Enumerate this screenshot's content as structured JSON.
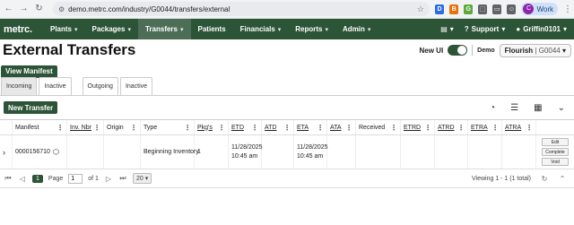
{
  "browser": {
    "url": "demo.metrc.com/industry/G0044/transfers/external",
    "profile_initial": "C",
    "profile_label": "Work",
    "ext_colors": [
      "#2d6cdf",
      "#e8710a",
      "#5fa83b",
      "#5f6368"
    ]
  },
  "nav": {
    "logo": "metrc.",
    "items": [
      {
        "label": "Plants"
      },
      {
        "label": "Packages"
      },
      {
        "label": "Transfers"
      },
      {
        "label": "Patients"
      },
      {
        "label": "Financials"
      },
      {
        "label": "Reports"
      },
      {
        "label": "Admin"
      }
    ],
    "active_index": 2,
    "support_label": "Support",
    "user_label": "Griffin0101"
  },
  "page": {
    "title": "External Transfers",
    "new_ui_label": "New UI",
    "demo_label": "Demo",
    "facility_name": "Flourish",
    "facility_code": "| G0044",
    "view_manifest_label": "View Manifest"
  },
  "tabs": [
    {
      "label": "Incoming"
    },
    {
      "label": "Inactive"
    },
    {
      "label": "Outgoing"
    },
    {
      "label": "Inactive"
    }
  ],
  "toolbar": {
    "new_transfer_label": "New Transfer"
  },
  "grid": {
    "columns": [
      "Manifest",
      "Inv. Nbr",
      "Origin",
      "Type",
      "Pkg's",
      "ETD",
      "ATD",
      "ETA",
      "ATA",
      "Received",
      "ETRD",
      "ATRD",
      "ETRA",
      "ATRA"
    ],
    "rows": [
      {
        "manifest": "0000156710",
        "inv_nbr": "",
        "origin": "",
        "type": "Beginning Inventory",
        "pkgs": "1",
        "etd_date": "11/28/2025",
        "etd_time": "10:45 am",
        "atd": "",
        "eta_date": "11/28/2025",
        "eta_time": "10:45 am",
        "ata": "",
        "received": "",
        "etrd": "",
        "atrd": "",
        "etra": "",
        "atra": "",
        "actions": [
          "Edit",
          "Complete",
          "Void"
        ]
      }
    ]
  },
  "footer": {
    "current_page": "1",
    "page_label": "Page",
    "page_input": "1",
    "of_label": "of 1",
    "page_size": "20",
    "viewing": "Viewing 1 - 1 (1 total)"
  }
}
